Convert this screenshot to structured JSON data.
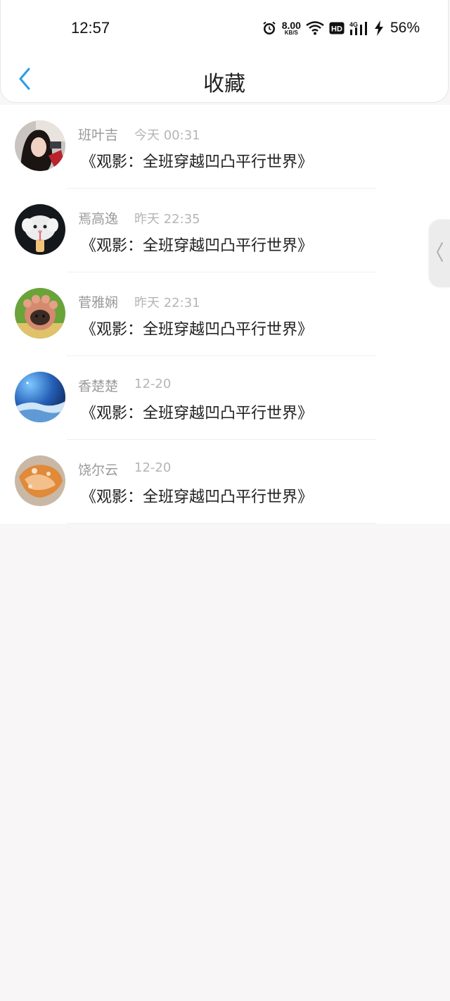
{
  "status_bar": {
    "time": "12:57",
    "net_speed_value": "8.00",
    "net_speed_unit": "KB/S",
    "hd_badge": "HD",
    "network_type": "4G",
    "battery": "56%",
    "icons": [
      "alarm-icon",
      "wifi-icon",
      "hd-icon",
      "cell-signal-icon",
      "charging-icon"
    ]
  },
  "header": {
    "title": "收藏",
    "back_icon": "chevron-left-icon"
  },
  "colors": {
    "accent": "#2d9be4",
    "background": "#f8f6f7",
    "card": "#ffffff"
  },
  "favorites": [
    {
      "name": "班叶吉",
      "time": "今天 00:31",
      "title": "《观影：全班穿越凹凸平行世界》"
    },
    {
      "name": "焉高逸",
      "time": "昨天 22:35",
      "title": "《观影：全班穿越凹凸平行世界》"
    },
    {
      "name": "菅雅娴",
      "time": "昨天 22:31",
      "title": "《观影：全班穿越凹凸平行世界》"
    },
    {
      "name": "香楚楚",
      "time": "12-20",
      "title": "《观影：全班穿越凹凸平行世界》"
    },
    {
      "name": "饶尔云",
      "time": "12-20",
      "title": "《观影：全班穿越凹凸平行世界》"
    }
  ]
}
